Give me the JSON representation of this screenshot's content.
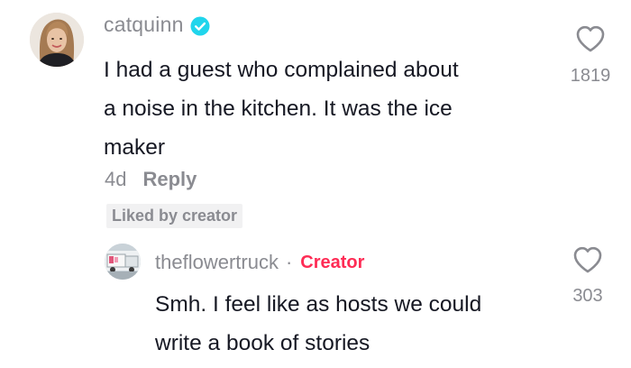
{
  "comments": [
    {
      "username": "catquinn",
      "verified": true,
      "text_lines": [
        "I had a guest who complained about",
        "a noise in the kitchen. It was the ice",
        "maker"
      ],
      "age": "4d",
      "reply_label": "Reply",
      "liked_by_creator_label": "Liked by creator",
      "like_count": "1819"
    },
    {
      "username": "theflowertruck",
      "separator": "·",
      "creator_label": "Creator",
      "text_lines": [
        "Smh. I feel like as hosts we could",
        "write a book of stories"
      ],
      "like_count": "303"
    }
  ],
  "colors": {
    "muted_text": "#8a8b91",
    "body_text": "#161823",
    "creator_red": "#fe2c55",
    "verified_blue": "#20d5ec",
    "badge_bg": "#f1f1f2"
  },
  "icons": {
    "like": "heart-outline-icon",
    "verified": "verified-check-icon"
  }
}
